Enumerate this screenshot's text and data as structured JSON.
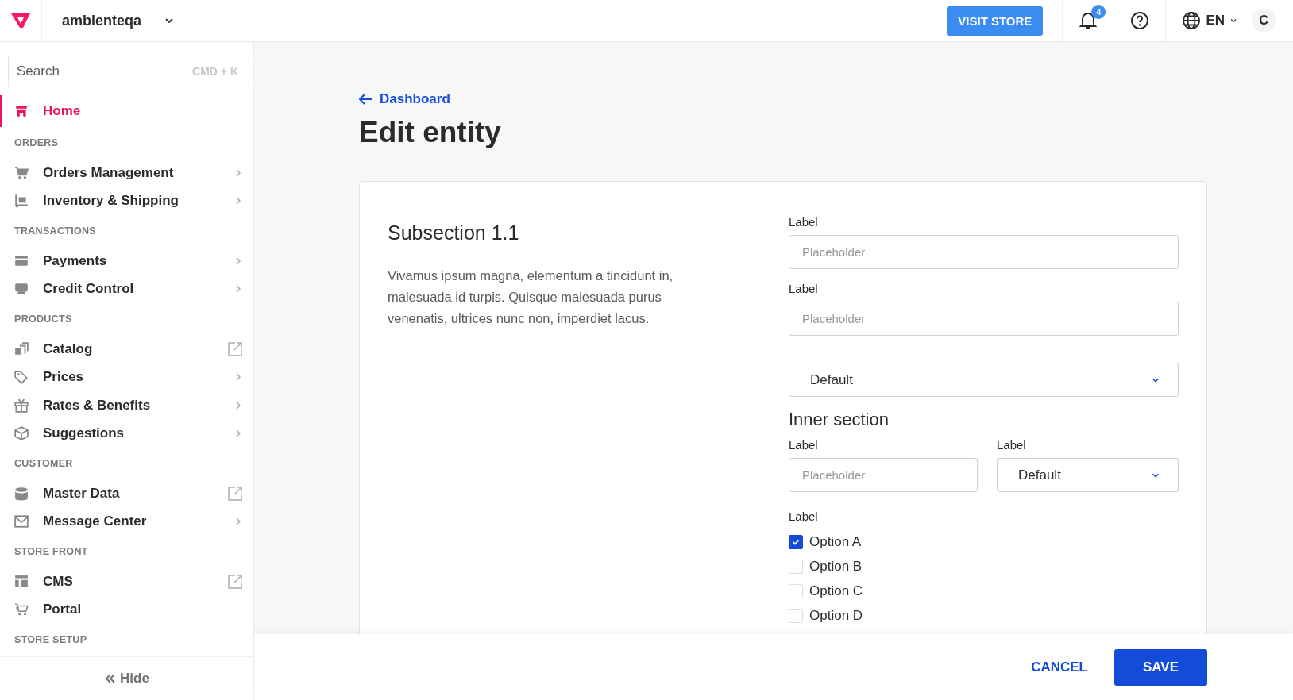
{
  "topbar": {
    "account": "ambienteqa",
    "visit_store": "VISIT STORE",
    "notifications": "4",
    "language": "EN",
    "avatar": "C"
  },
  "sidebar": {
    "search": {
      "placeholder": "Search",
      "shortcut": "CMD + K"
    },
    "sections": [
      {
        "items": [
          {
            "label": "Home",
            "kind": "link",
            "selected": true
          }
        ]
      },
      {
        "title": "ORDERS",
        "items": [
          {
            "label": "Orders Management",
            "kind": "submenu",
            "selected": false
          },
          {
            "label": "Inventory & Shipping",
            "kind": "submenu",
            "selected": false
          }
        ]
      },
      {
        "title": "TRANSACTIONS",
        "items": [
          {
            "label": "Payments",
            "kind": "submenu",
            "selected": false
          },
          {
            "label": "Credit Control",
            "kind": "submenu",
            "selected": false
          }
        ]
      },
      {
        "title": "PRODUCTS",
        "items": [
          {
            "label": "Catalog",
            "kind": "external",
            "selected": false
          },
          {
            "label": "Prices",
            "kind": "submenu",
            "selected": false
          },
          {
            "label": "Rates & Benefits",
            "kind": "submenu",
            "selected": false
          },
          {
            "label": "Suggestions",
            "kind": "submenu",
            "selected": false
          }
        ]
      },
      {
        "title": "CUSTOMER",
        "items": [
          {
            "label": "Master Data",
            "kind": "external",
            "selected": false
          },
          {
            "label": "Message Center",
            "kind": "submenu",
            "selected": false
          }
        ]
      },
      {
        "title": "STORE FRONT",
        "items": [
          {
            "label": "CMS",
            "kind": "external",
            "selected": false
          },
          {
            "label": "Portal",
            "kind": "link",
            "selected": false
          }
        ]
      },
      {
        "title": "STORE SETUP"
      }
    ],
    "hide": "Hide"
  },
  "page": {
    "back": "Dashboard",
    "title": "Edit entity"
  },
  "card": {
    "title": "Subsection 1.1",
    "description": "Vivamus ipsum magna, elementum a tincidunt in, malesuada id turpis. Quisque malesuada purus venenatis, ultrices nunc non, imperdiet lacus.",
    "fields": [
      {
        "kind": "text",
        "label": "Label",
        "placeholder": "Placeholder"
      },
      {
        "kind": "text",
        "label": "Label",
        "placeholder": "Placeholder"
      },
      {
        "kind": "select",
        "value": "Default"
      },
      {
        "kind": "heading",
        "text": "Inner section"
      },
      {
        "kind": "row",
        "children": [
          {
            "kind": "text",
            "label": "Label",
            "placeholder": "Placeholder"
          },
          {
            "kind": "select",
            "label": "Label",
            "value": "Default"
          }
        ]
      },
      {
        "kind": "checkboxes",
        "label": "Label",
        "options": [
          {
            "label": "Option A",
            "checked": true
          },
          {
            "label": "Option B",
            "checked": false
          },
          {
            "label": "Option C",
            "checked": false
          },
          {
            "label": "Option D",
            "checked": false
          }
        ]
      }
    ]
  },
  "footer": {
    "cancel": "CANCEL",
    "save": "SAVE"
  }
}
